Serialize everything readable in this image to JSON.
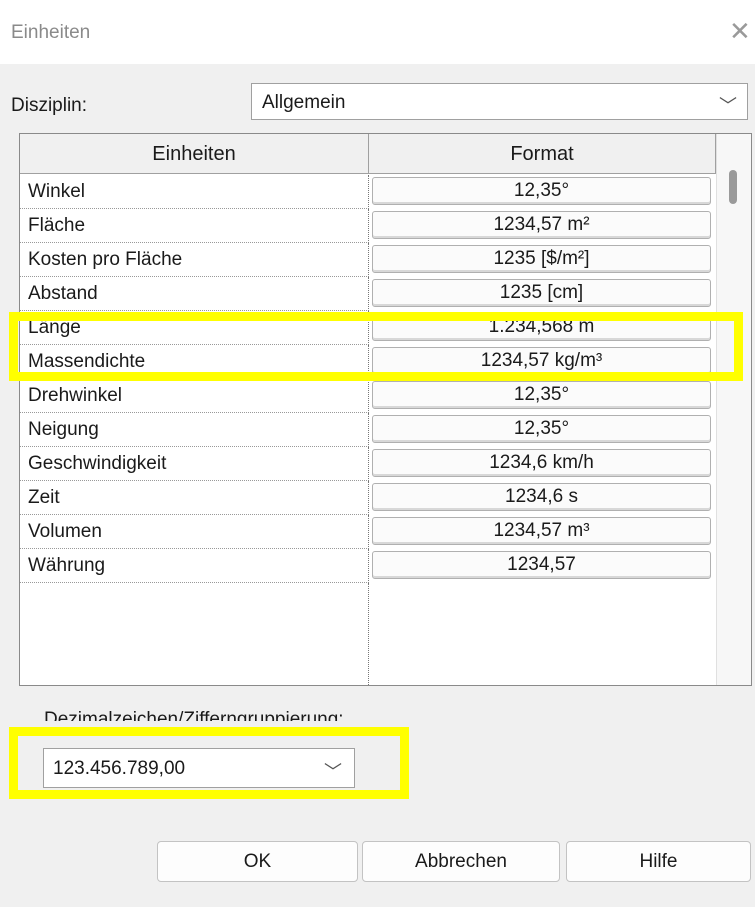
{
  "window": {
    "title": "Einheiten",
    "close_glyph": "✕"
  },
  "disziplin": {
    "label": "Disziplin:",
    "value": "Allgemein"
  },
  "table": {
    "headers": {
      "units": "Einheiten",
      "format": "Format"
    },
    "rows": [
      {
        "name": "Winkel",
        "format": "12,35°"
      },
      {
        "name": "Fläche",
        "format": "1234,57 m²"
      },
      {
        "name": "Kosten pro Fläche",
        "format": "1235 [$/m²]"
      },
      {
        "name": "Abstand",
        "format": "1235 [cm]"
      },
      {
        "name": "Länge",
        "format": "1.234,568 m"
      },
      {
        "name": "Massendichte",
        "format": "1234,57 kg/m³"
      },
      {
        "name": "Drehwinkel",
        "format": "12,35°"
      },
      {
        "name": "Neigung",
        "format": "12,35°"
      },
      {
        "name": "Geschwindigkeit",
        "format": "1234,6 km/h"
      },
      {
        "name": "Zeit",
        "format": "1234,6 s"
      },
      {
        "name": "Volumen",
        "format": "1234,57 m³"
      },
      {
        "name": "Währung",
        "format": "1234,57"
      }
    ]
  },
  "decimal": {
    "label": "Dezimalzeichen/Zifferngruppierung:",
    "value": "123.456.789,00"
  },
  "buttons": {
    "ok": "OK",
    "cancel": "Abbrechen",
    "help": "Hilfe"
  },
  "colors": {
    "highlight": "#ffff00",
    "dialog_bg": "#f0f0f0"
  }
}
